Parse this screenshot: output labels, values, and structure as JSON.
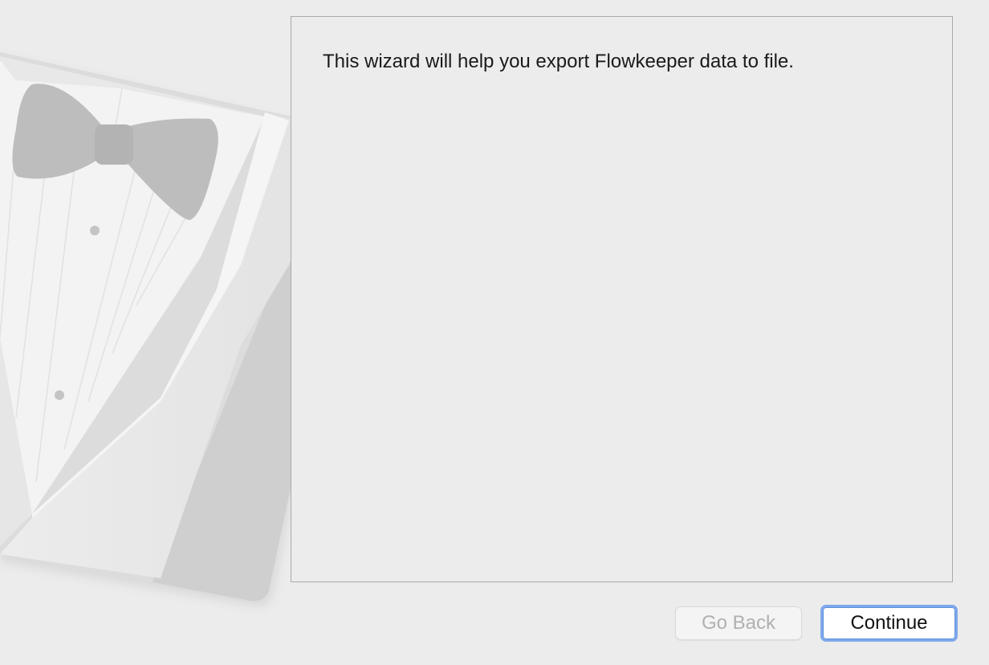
{
  "wizard": {
    "intro_text": "This wizard will help you export Flowkeeper data to file."
  },
  "buttons": {
    "back_label": "Go Back",
    "continue_label": "Continue"
  },
  "icons": {
    "watermark": "tuxedo-icon"
  },
  "colors": {
    "background": "#ececec",
    "panel_border": "#a9a9a9",
    "focus_ring": "#7fa9ea",
    "disabled_text": "#b0b0b0"
  },
  "state": {
    "back_enabled": false,
    "continue_focused": true
  }
}
